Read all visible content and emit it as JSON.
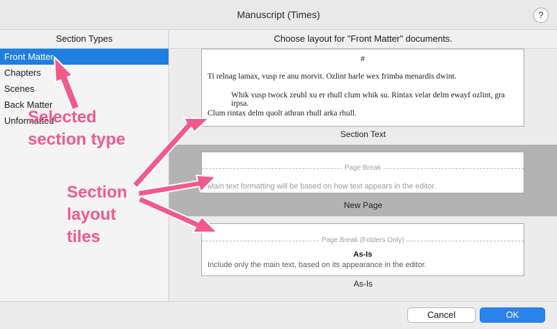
{
  "window": {
    "title": "Manuscript (Times)",
    "help_label": "?"
  },
  "sidebar": {
    "header": "Section Types",
    "items": [
      {
        "label": "Front Matter"
      },
      {
        "label": "Chapters"
      },
      {
        "label": "Scenes"
      },
      {
        "label": "Back Matter"
      },
      {
        "label": "Unformatted"
      }
    ]
  },
  "main": {
    "header": "Choose layout for \"Front Matter\" documents.",
    "tiles": [
      {
        "caption": "Section Text",
        "hash": "#",
        "paragraphs": [
          "Ti relnag lamax, vusp re anu morvit. Ozlint harle wex frimba menardis dwint.",
          "Whik vusp twock zeuhl xu er rhull clum whik su. Rintax velar delm ewayf ozlint, gra irpsa.",
          "Clum rintax delm quolt athran rhull arka rhull."
        ]
      },
      {
        "caption": "New Page",
        "break_label": "Page Break",
        "note": "Main text formatting will be based on how text appears in the editor."
      },
      {
        "caption": "As-Is",
        "break_label": "Page Break (Folders Only)",
        "title": "As-Is",
        "note": "Include only the main text, based on its appearance in the editor."
      }
    ]
  },
  "footer": {
    "cancel_label": "Cancel",
    "ok_label": "OK"
  },
  "annotations": {
    "selected_line1": "Selected",
    "selected_line2": "section type",
    "tiles_line1": "Section",
    "tiles_line2": "layout",
    "tiles_line3": "tiles",
    "color": "#f15a8a"
  }
}
